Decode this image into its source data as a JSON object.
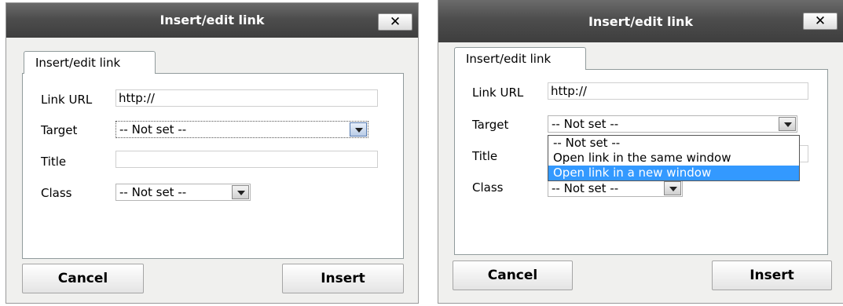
{
  "colors": {
    "titlebar": "#4d4d4d",
    "dialog_bg": "#f0f0ee",
    "panel_border": "#919b9c",
    "selection": "#3399ff"
  },
  "dialogs": [
    {
      "title": "Insert/edit link",
      "close_icon": "close-icon",
      "close_glyph": "✕",
      "tab": "Insert/edit link",
      "fields": {
        "link_url": {
          "label": "Link URL",
          "value": "http://"
        },
        "target": {
          "label": "Target",
          "value": "-- Not set --"
        },
        "title": {
          "label": "Title",
          "value": ""
        },
        "class": {
          "label": "Class",
          "value": "-- Not set --"
        }
      },
      "buttons": {
        "cancel": "Cancel",
        "insert": "Insert"
      }
    },
    {
      "title": "Insert/edit link",
      "close_icon": "close-icon",
      "close_glyph": "✕",
      "tab": "Insert/edit link",
      "fields": {
        "link_url": {
          "label": "Link URL",
          "value": "http://"
        },
        "target": {
          "label": "Target",
          "value": "-- Not set --",
          "options": [
            "-- Not set --",
            "Open link in the same window",
            "Open link in a new window"
          ],
          "highlighted_option": "Open link in a new window"
        },
        "title": {
          "label": "Title",
          "value": ""
        },
        "class": {
          "label": "Class",
          "value": "-- Not set --"
        }
      },
      "buttons": {
        "cancel": "Cancel",
        "insert": "Insert"
      }
    }
  ]
}
